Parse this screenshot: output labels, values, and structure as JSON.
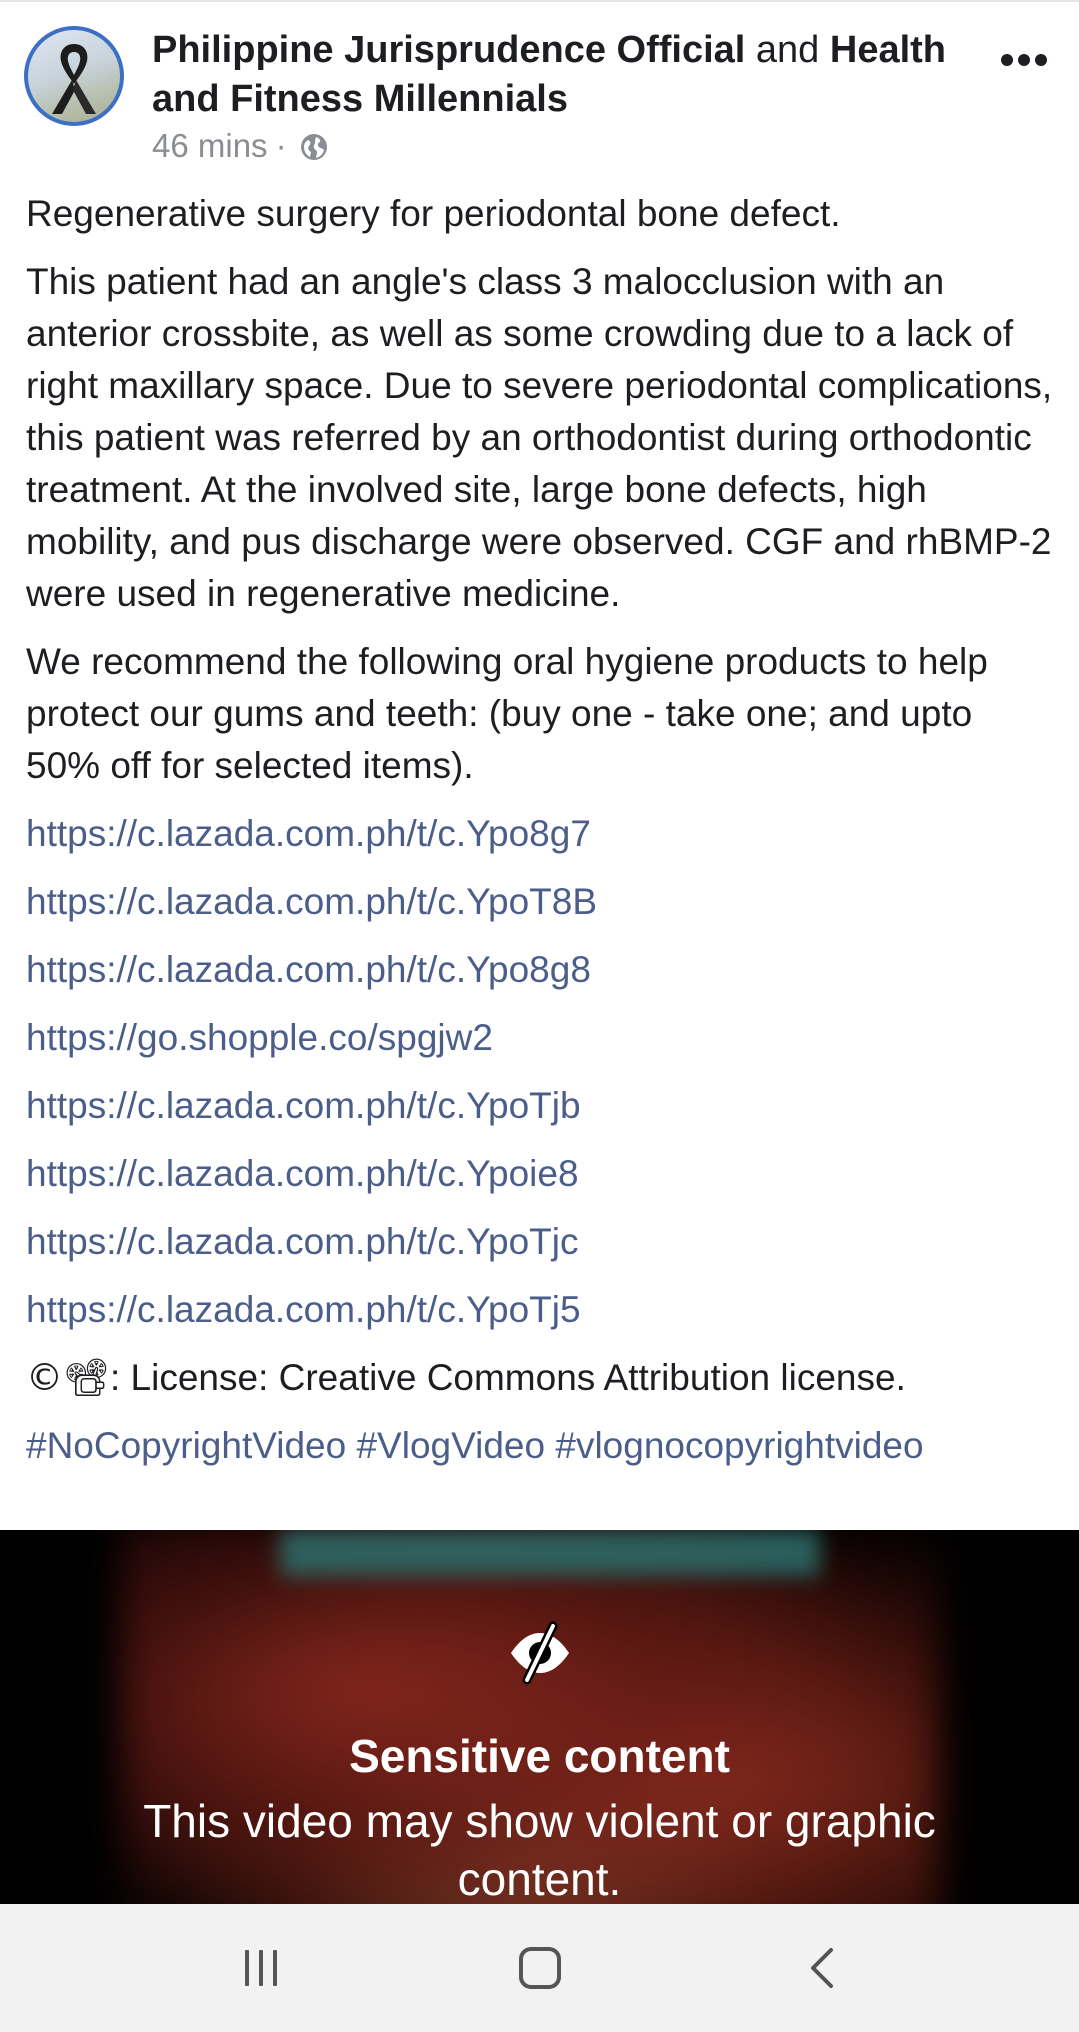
{
  "post": {
    "author_1": "Philippine Jurisprudence Official",
    "connector": "and",
    "author_2": "Health and Fitness Millennials",
    "time": "46 mins",
    "dot": "·",
    "avatar_icon": "black-ribbon-icon",
    "privacy_icon": "globe-icon",
    "more_icon": "more-options-icon"
  },
  "body": {
    "title": "Regenerative surgery for periodontal bone defect.",
    "paragraph_1": "This patient had an angle's class 3 malocclusion with an anterior crossbite, as well as some crowding due to a lack of right maxillary space. Due to severe periodontal complications, this patient was referred by an orthodontist during orthodontic treatment. At the involved site, large bone defects, high mobility, and pus discharge were observed. CGF and rhBMP-2 were used in regenerative medicine.",
    "paragraph_2": "We recommend the following oral hygiene products to help protect our gums and teeth: (buy one - take one; and upto 50% off for selected items).",
    "links": [
      "https://c.lazada.com.ph/t/c.Ypo8g7",
      "https://c.lazada.com.ph/t/c.YpoT8B",
      "https://c.lazada.com.ph/t/c.Ypo8g8",
      "https://go.shopple.co/spgjw2",
      "https://c.lazada.com.ph/t/c.YpoTjb",
      "https://c.lazada.com.ph/t/c.Ypoie8",
      "https://c.lazada.com.ph/t/c.YpoTjc",
      "https://c.lazada.com.ph/t/c.YpoTj5"
    ],
    "license_emoji": "©📽",
    "license_text": ": License: Creative Commons Attribution license.",
    "hashtags": [
      "#NoCopyrightVideo",
      "#VlogVideo",
      "#vlognocopyrightvideo"
    ]
  },
  "media": {
    "warning_icon": "eye-slash-icon",
    "warning_title": "Sensitive content",
    "warning_text": "This video may show violent or graphic content."
  },
  "navbar": {
    "recents_icon": "recent-apps-icon",
    "home_icon": "home-icon",
    "back_icon": "back-icon"
  },
  "colors": {
    "link": "#4b5e8a",
    "text": "#1c1e21",
    "meta": "#8a8d91",
    "avatar_ring": "#3d6fc4",
    "navbar_bg": "#f2f2f2"
  }
}
